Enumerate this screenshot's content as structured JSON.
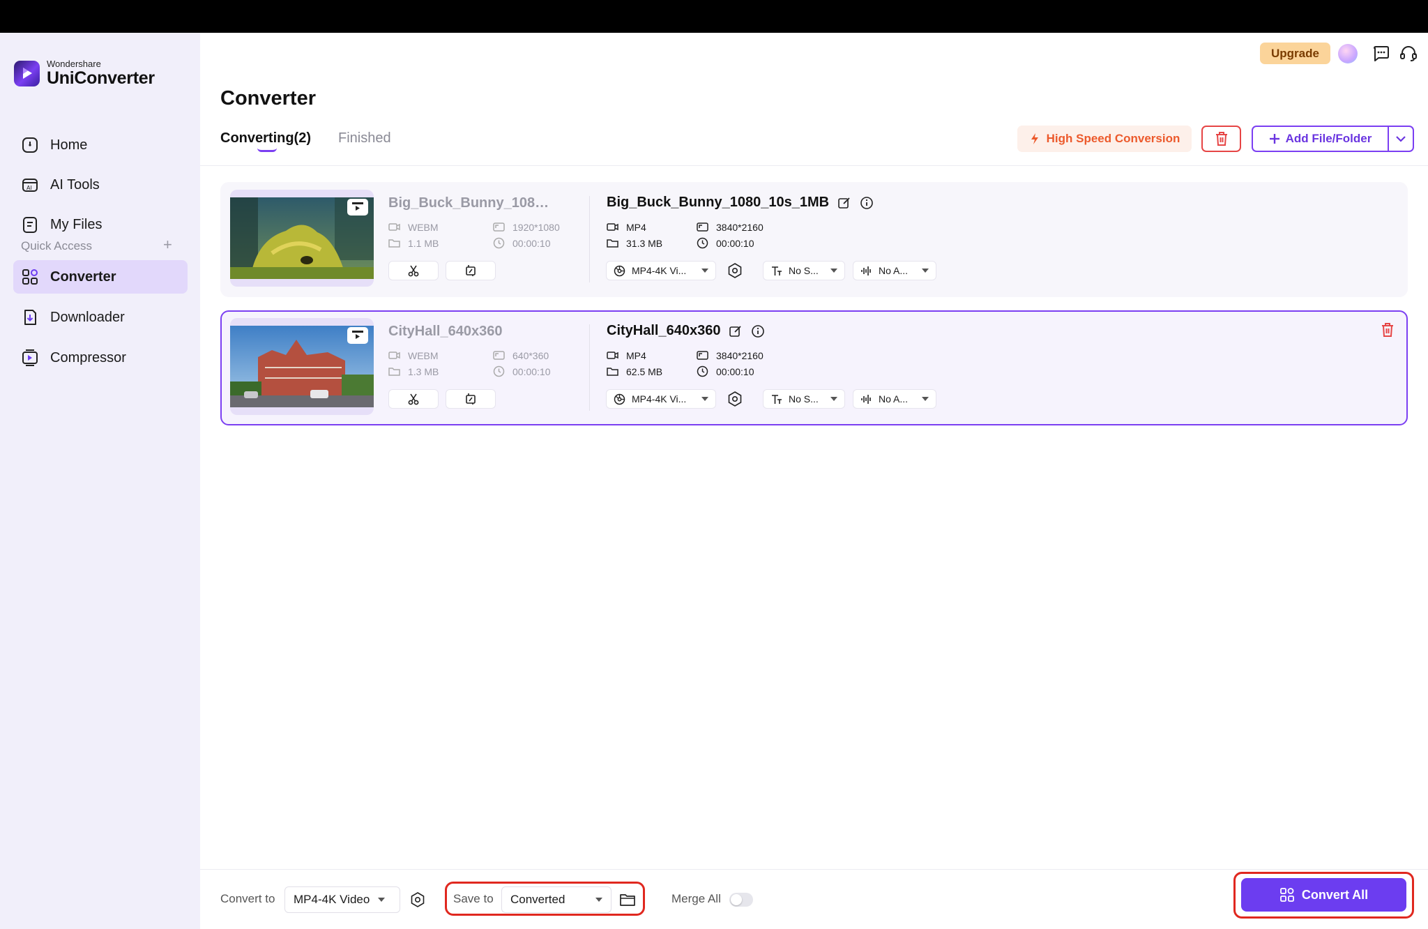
{
  "app": {
    "brand_small": "Wondershare",
    "brand_name": "UniConverter"
  },
  "sidebar": {
    "items": [
      {
        "label": "Home",
        "icon": "home-icon"
      },
      {
        "label": "AI Tools",
        "icon": "ai-tools-icon"
      },
      {
        "label": "My Files",
        "icon": "file-icon"
      }
    ],
    "quick_access_label": "Quick Access",
    "quick_items": [
      {
        "label": "Converter",
        "icon": "converter-icon",
        "active": true
      },
      {
        "label": "Downloader",
        "icon": "download-icon",
        "active": false
      },
      {
        "label": "Compressor",
        "icon": "compressor-icon",
        "active": false
      }
    ]
  },
  "header": {
    "upgrade_label": "Upgrade"
  },
  "page": {
    "title": "Converter"
  },
  "tabs": [
    {
      "label": "Converting(2)",
      "active": true
    },
    {
      "label": "Finished",
      "active": false
    }
  ],
  "toolbar": {
    "high_speed_label": "High Speed Conversion",
    "add_label": "Add File/Folder"
  },
  "files": [
    {
      "source": {
        "name": "Big_Buck_Bunny_1080_...",
        "format": "WEBM",
        "resolution": "1920*1080",
        "size": "1.1 MB",
        "duration": "00:00:10"
      },
      "target": {
        "name": "Big_Buck_Bunny_1080_10s_1MB",
        "format": "MP4",
        "resolution": "3840*2160",
        "size": "31.3 MB",
        "duration": "00:00:10"
      },
      "preset": "MP4-4K Vi...",
      "subtitle": "No S...",
      "audio": "No A..."
    },
    {
      "source": {
        "name": "CityHall_640x360",
        "format": "WEBM",
        "resolution": "640*360",
        "size": "1.3 MB",
        "duration": "00:00:10"
      },
      "target": {
        "name": "CityHall_640x360",
        "format": "MP4",
        "resolution": "3840*2160",
        "size": "62.5 MB",
        "duration": "00:00:10"
      },
      "preset": "MP4-4K Vi...",
      "subtitle": "No S...",
      "audio": "No A..."
    }
  ],
  "bottom": {
    "convert_to_label": "Convert to",
    "convert_to_value": "MP4-4K Video",
    "save_to_label": "Save to",
    "save_to_value": "Converted",
    "merge_label": "Merge All",
    "merge_on": false,
    "convert_all_label": "Convert All"
  },
  "colors": {
    "accent": "#6c3df0",
    "danger": "#e0281f",
    "warning": "#ec5a2c",
    "sidebar_bg": "#f1effa"
  }
}
